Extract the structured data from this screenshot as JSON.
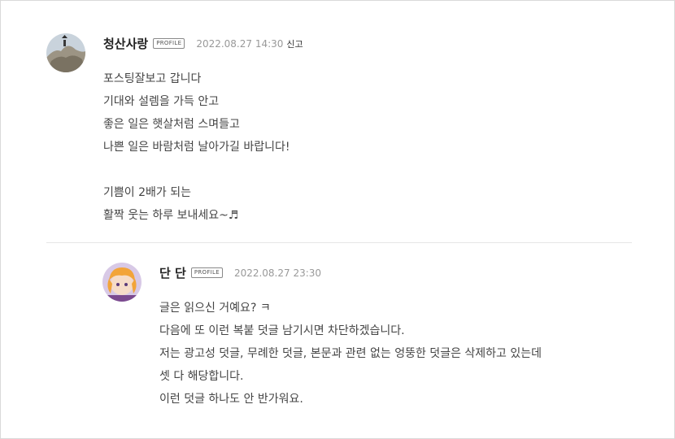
{
  "comments": [
    {
      "author": "청산사랑",
      "badge": "PROFILE",
      "date": "2022.08.27 14:30",
      "report_label": "신고",
      "lines": [
        "포스팅잘보고 갑니다",
        "기대와 설렘을 가득 안고",
        "좋은 일은 햇살처럼 스며들고",
        "나쁜 일은 바람처럼 날아가길 바랍니다!",
        "",
        "기쁨이 2배가 되는",
        "활짝 웃는 하루 보내세요~♬"
      ]
    },
    {
      "author": "단 단",
      "badge": "PROFILE",
      "date": "2022.08.27 23:30",
      "lines": [
        "글은 읽으신 거예요? ㅋ",
        "다음에 또 이런 복붙 덧글 남기시면 차단하겠습니다.",
        "저는 광고성 덧글, 무례한 덧글, 본문과 관련 없는 엉뚱한 덧글은 삭제하고 있는데",
        "셋 다 해당합니다.",
        "이런 덧글 하나도 안 반가워요."
      ]
    }
  ]
}
